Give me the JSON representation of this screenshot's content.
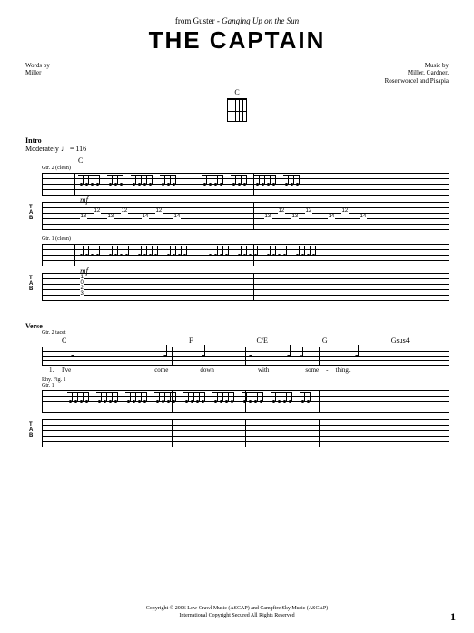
{
  "header": {
    "from_prefix": "from Guster - ",
    "album": "Ganging Up on the Sun",
    "title": "THE CAPTAIN"
  },
  "credits": {
    "words_label": "Words by",
    "words_by": "Miller",
    "music_label": "Music by",
    "music_by_line1": "Miller, Gardner,",
    "music_by_line2": "Rosenworcel and Pisapia"
  },
  "chord_diagram": {
    "name": "C"
  },
  "intro": {
    "section": "Intro",
    "tempo": "Moderately ♩ = 116",
    "gtr2": {
      "label": "Gtr. 2 (clean)",
      "chord": "C",
      "dynamic": "mf",
      "tab_numbers": [
        "13",
        "12",
        "13",
        "12",
        "14",
        "12",
        "14",
        "13",
        "12",
        "13",
        "12",
        "14",
        "12",
        "14"
      ]
    },
    "gtr1": {
      "label": "Gtr. 1 (clean)",
      "dynamic": "mf",
      "tab_col": [
        "1",
        "0",
        "2",
        "3"
      ]
    }
  },
  "verse": {
    "section": "Verse",
    "part_label": "Gtr. 2 tacet",
    "chords": [
      "C",
      "F",
      "C/E",
      "G",
      "Gsus4"
    ],
    "lyric_num": "1.",
    "lyrics": [
      "I've",
      "come",
      "down",
      "with",
      "some",
      "-",
      "thing."
    ],
    "rhy_label": "Rhy. Fig. 1",
    "gtr1_label": "Gtr. 1"
  },
  "footer": {
    "line1": "Copyright © 2006 Low Crawl Music (ASCAP) and Campfire Sky Music (ASCAP)",
    "line2": "International Copyright Secured   All Rights Reserved"
  },
  "page_number": "1",
  "tab_marker": {
    "T": "T",
    "A": "A",
    "B": "B"
  }
}
